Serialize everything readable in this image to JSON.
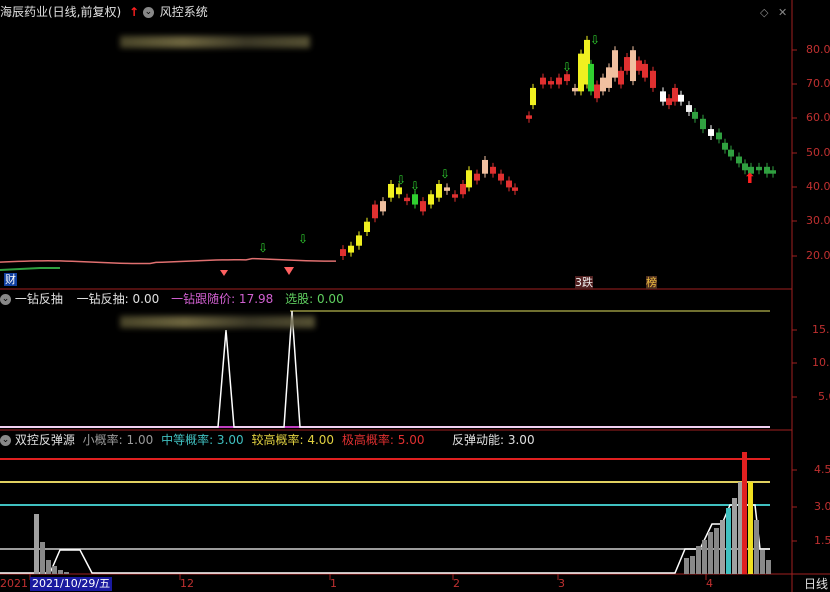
{
  "main_panel": {
    "title": "海辰药业(日线,前复权)",
    "formula": "风控系统",
    "y_ticks": [
      "80.00",
      "70.00",
      "60.00",
      "50.00",
      "40.00",
      "30.00",
      "20.00"
    ],
    "markers": {
      "cai": "财",
      "jilian": "3跌",
      "bang": "榜"
    }
  },
  "panel2": {
    "name": "一钻反抽",
    "values": [
      {
        "label": "一钻反抽: 0.00",
        "color": "#e0e0e0"
      },
      {
        "label": "一钻跟随价: 17.98",
        "color": "#d060d0"
      },
      {
        "label": "选股: 0.00",
        "color": "#60d060"
      }
    ],
    "y_ticks": [
      "15.00",
      "10.00",
      "5.00"
    ]
  },
  "panel3": {
    "name": "双控反弹源",
    "values": [
      {
        "label": "小概率: 1.00",
        "color": "#9a9a9a"
      },
      {
        "label": "中等概率: 3.00",
        "color": "#40c0c0"
      },
      {
        "label": "较高概率: 4.00",
        "color": "#e0d040"
      },
      {
        "label": "极高概率: 5.00",
        "color": "#e03030"
      },
      {
        "label": "反弹动能: 3.00",
        "color": "#e0e0e0"
      }
    ],
    "y_ticks": [
      "4.5",
      "3.0",
      "1.5"
    ]
  },
  "time_axis": {
    "year_prefix": "2021",
    "cursor_date": "2021/10/29/五",
    "ticks": [
      "12",
      "1",
      "2",
      "3",
      "4"
    ],
    "period": "日线"
  },
  "colors": {
    "up": "#ff3030",
    "down": "#30c0c0",
    "yellow": "#f0f020",
    "green": "#30d030",
    "pink": "#e07070",
    "axis": "#a02020"
  }
}
